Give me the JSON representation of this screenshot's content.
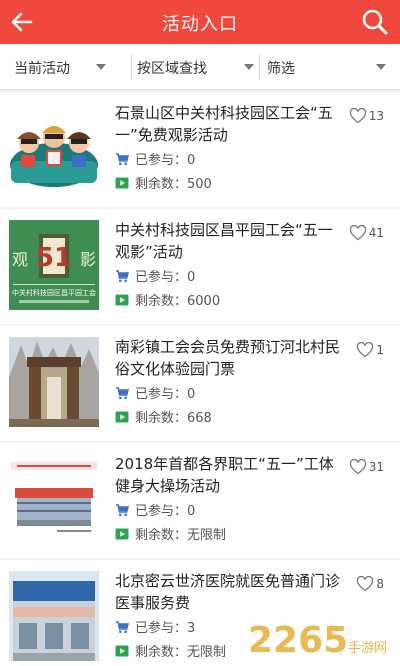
{
  "header": {
    "title": "活动入口",
    "back_icon": "back-arrow-icon",
    "search_icon": "search-icon",
    "bg_color": "#f0483c"
  },
  "filters": [
    {
      "label": "当前活动"
    },
    {
      "label": "按区域查找"
    },
    {
      "label": "筛选"
    }
  ],
  "items": [
    {
      "title": "石景山区中关村科技园区工会“五一”免费观影活动",
      "likes": "13",
      "joined": "已参与：0",
      "remaining": "剩余数：500",
      "thumb": "movie-audience-thumb"
    },
    {
      "title": "中关村科技园区昌平园工会“五一观影”活动",
      "likes": "41",
      "joined": "已参与：0",
      "remaining": "剩余数：6000",
      "thumb": "green-poster-thumb",
      "thumb_text_left": "观",
      "thumb_text_right": "影",
      "thumb_caption": "中关村科技园区昌平园工会"
    },
    {
      "title": "南彩镇工会会员免费预订河北村民俗文化体验园门票",
      "likes": "1",
      "joined": "已参与：0",
      "remaining": "剩余数：668",
      "thumb": "gate-photo-thumb"
    },
    {
      "title": "2018年首都各界职工“五一”工体健身大操场活动",
      "likes": "31",
      "joined": "已参与：0",
      "remaining": "剩余数：无限制",
      "thumb": "stadium-thumb"
    },
    {
      "title": "北京密云世济医院就医免普通门诊医事服务费",
      "likes": "8",
      "joined": "已参与：3",
      "remaining": "剩余数：无限制",
      "thumb": "hospital-thumb"
    }
  ],
  "watermark": {
    "text": "2265",
    "sub": "手游网"
  }
}
